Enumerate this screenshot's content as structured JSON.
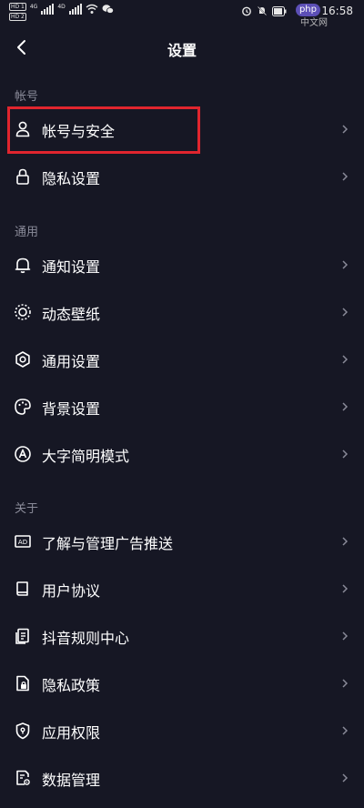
{
  "status_bar": {
    "hd_top": "HD 1",
    "hd_bottom": "HD 2",
    "network_1": "4G",
    "network_2": "4D",
    "badge": "php",
    "watermark": "中文网",
    "time": "16:58"
  },
  "header": {
    "title": "设置"
  },
  "sections": [
    {
      "label": "帐号"
    },
    {
      "label": "通用"
    },
    {
      "label": "关于"
    }
  ],
  "items": [
    {
      "label": "帐号与安全",
      "icon": "user-icon"
    },
    {
      "label": "隐私设置",
      "icon": "lock-icon"
    },
    {
      "label": "通知设置",
      "icon": "bell-icon"
    },
    {
      "label": "动态壁纸",
      "icon": "dynamic-wallpaper-icon"
    },
    {
      "label": "通用设置",
      "icon": "gear-icon"
    },
    {
      "label": "背景设置",
      "icon": "palette-icon"
    },
    {
      "label": "大字简明模式",
      "icon": "font-a-icon"
    },
    {
      "label": "了解与管理广告推送",
      "icon": "ad-icon"
    },
    {
      "label": "用户协议",
      "icon": "book-icon"
    },
    {
      "label": "抖音规则中心",
      "icon": "rules-doc-icon"
    },
    {
      "label": "隐私政策",
      "icon": "privacy-doc-icon"
    },
    {
      "label": "应用权限",
      "icon": "shield-icon"
    },
    {
      "label": "数据管理",
      "icon": "data-manage-icon"
    }
  ],
  "colors": {
    "background": "#161724",
    "highlight": "#e0252e",
    "section_label": "#8a8b99"
  }
}
